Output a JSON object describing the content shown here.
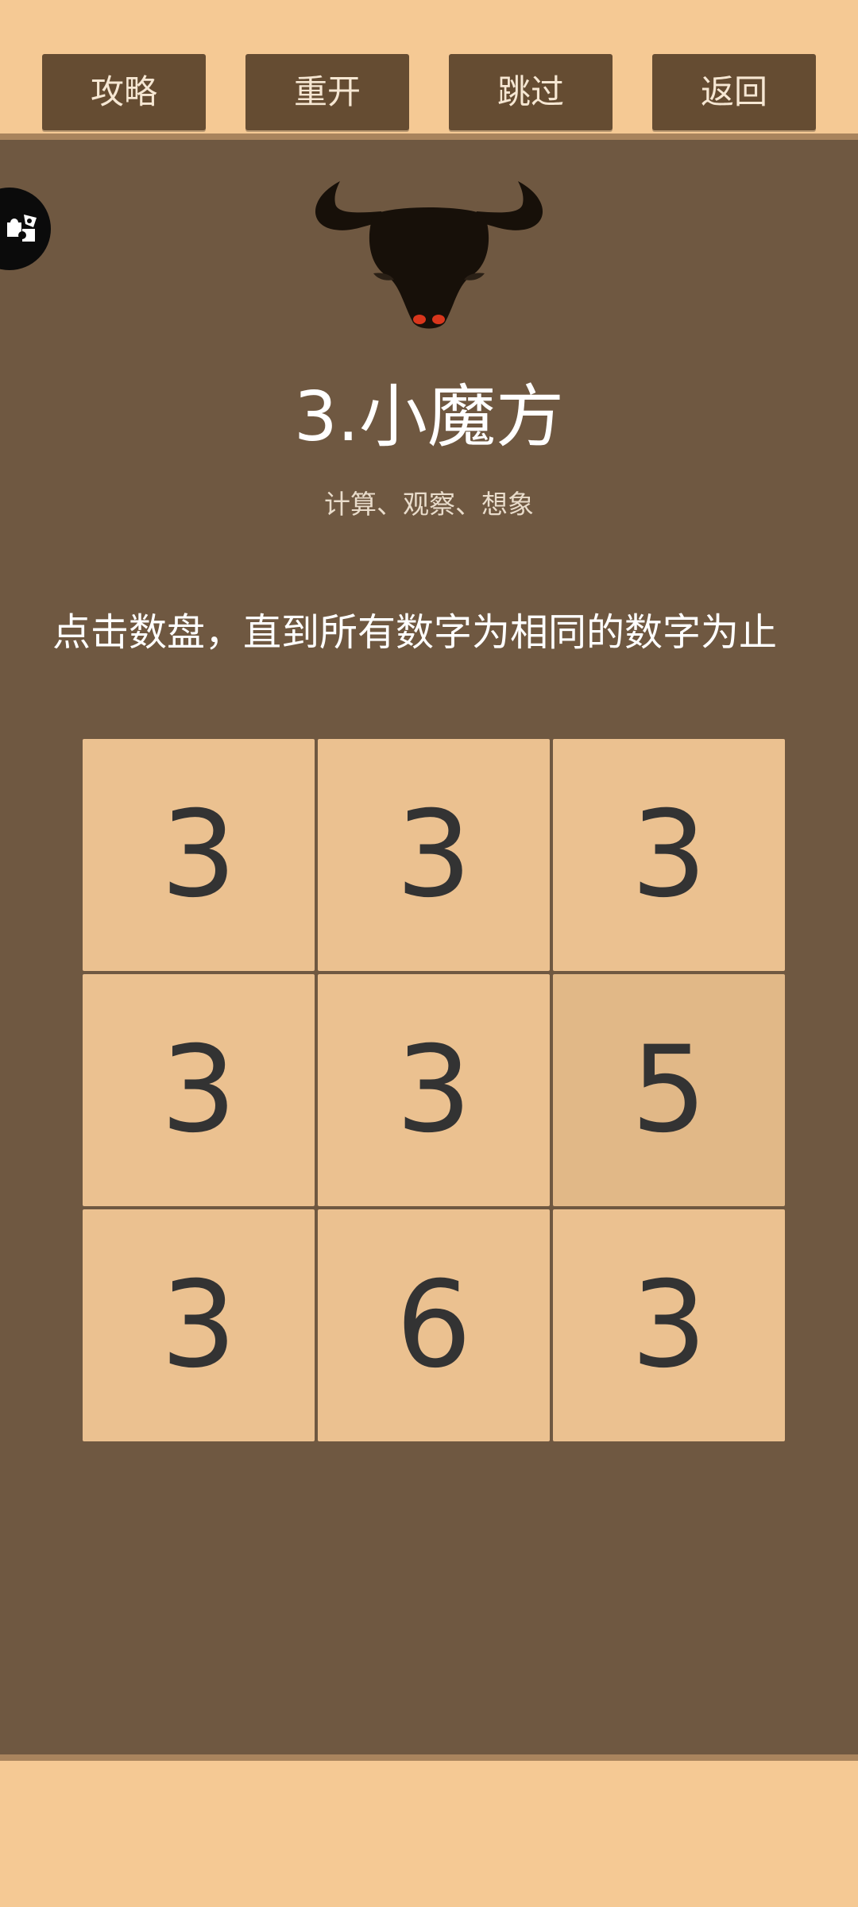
{
  "toolbar": {
    "guide_label": "攻略",
    "restart_label": "重开",
    "skip_label": "跳过",
    "back_label": "返回"
  },
  "level": {
    "title": "3.小魔方",
    "tags": "计算、观察、想象",
    "instruction": "点击数盘，直到所有数字为相同的数字为止"
  },
  "grid": {
    "rows": 3,
    "cols": 3,
    "cells": [
      "3",
      "3",
      "3",
      "3",
      "3",
      "5",
      "3",
      "6",
      "3"
    ]
  },
  "icons": {
    "side_tab": "puzzle-icon",
    "logo": "bull-head-icon"
  },
  "colors": {
    "background": "#f5c994",
    "panel": "#6f5841",
    "button": "#654c32",
    "cell": "#ebc190",
    "cell_alt": "#e1b887",
    "bull_eyes": "#d9361c"
  }
}
